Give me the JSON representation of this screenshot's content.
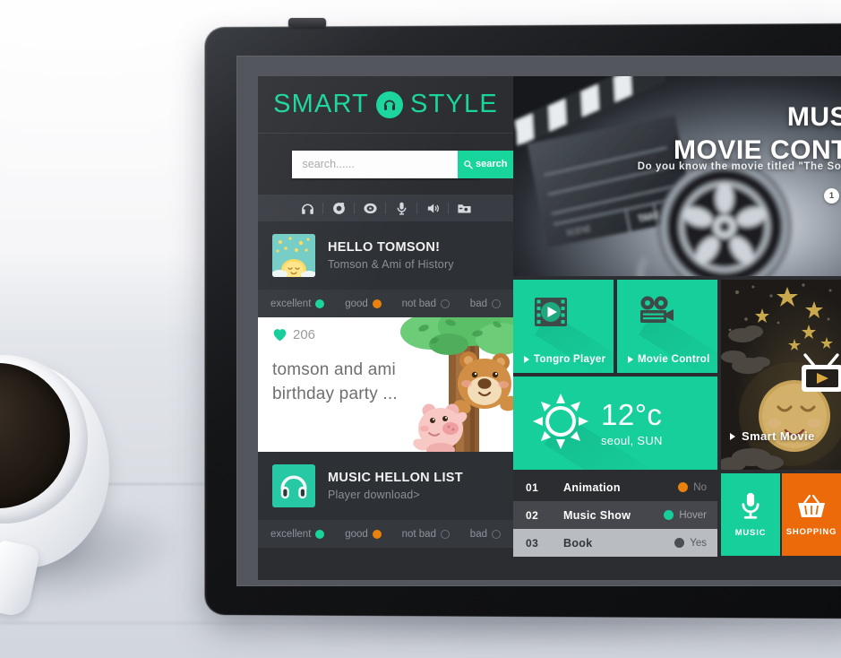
{
  "brand": {
    "word1": "SMART",
    "word2": "STYLE",
    "logo_icon": "headphones-logo-icon"
  },
  "search": {
    "placeholder": "search......",
    "value": "",
    "button_label": "search",
    "button_icon": "magnifier-icon"
  },
  "icon_bar": [
    {
      "name": "headphones-icon",
      "glyph": "♫"
    },
    {
      "name": "camera-icon",
      "glyph": "◉"
    },
    {
      "name": "disc-icon",
      "glyph": "◎"
    },
    {
      "name": "microphone-icon",
      "glyph": "♁"
    },
    {
      "name": "speaker-icon",
      "glyph": "◀"
    },
    {
      "name": "photo-folder-icon",
      "glyph": "▤"
    }
  ],
  "hello_panel": {
    "title": "HELLO TOMSON!",
    "subtitle": "Tomson & Ami of History",
    "thumb_icon": "sun-character-thumbnail"
  },
  "rating": {
    "items": [
      {
        "label": "excellent",
        "state": "green"
      },
      {
        "label": "good",
        "state": "orange"
      },
      {
        "label": "not bad",
        "state": "empty"
      },
      {
        "label": "bad",
        "state": "empty"
      }
    ]
  },
  "feature_card": {
    "like_icon": "heart-icon",
    "like_count": "206",
    "text_line1": "tomson and ami",
    "text_line2": "birthday party ...",
    "illustration": "bear-and-pig-tree-illustration"
  },
  "music_panel": {
    "title": "MUSIC HELLON LIST",
    "subtitle": "Player download>",
    "thumb_icon": "headphones-thumbnail"
  },
  "hero": {
    "title_line1": "MUS",
    "title_line2": "MOVIE CONT",
    "subtitle": "Do you know the movie titled \"The Sou",
    "pager": "1",
    "background": "film-clapperboard-and-reel-photo"
  },
  "tiles": [
    {
      "label": "Tongro Player",
      "icon": "film-play-icon",
      "color": "#16cf9b"
    },
    {
      "label": "Movie Control",
      "icon": "movie-camera-icon",
      "color": "#16cf9b"
    }
  ],
  "weather": {
    "icon": "sun-icon",
    "temperature": "12°c",
    "location": "seoul, SUN",
    "color": "#16cf9b"
  },
  "night_tile": {
    "label": "Smart Movie",
    "icon": "tv-play-icon",
    "illustration": "sleeping-moon-starry-night"
  },
  "list": {
    "rows": [
      {
        "num": "01",
        "name": "Animation",
        "state_label": "No",
        "dot_color": "#e8820c"
      },
      {
        "num": "02",
        "name": "Music Show",
        "state_label": "Hover",
        "dot_color": "#16cf9b"
      },
      {
        "num": "03",
        "name": "Book",
        "state_label": "Yes",
        "dot_color": "#4b4e54"
      }
    ]
  },
  "bottom_tiles": [
    {
      "label": "MUSIC",
      "icon": "microphone-icon",
      "color": "#16cf9b"
    },
    {
      "label": "SHOPPING",
      "icon": "shopping-basket-icon",
      "color": "#ec6a09"
    }
  ],
  "colors": {
    "accent_green": "#16cf9b",
    "accent_orange": "#ec6a09",
    "panel_dark": "#2b2d31",
    "panel_mid": "#393c42"
  }
}
